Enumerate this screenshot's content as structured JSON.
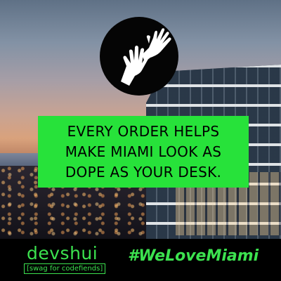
{
  "logo": {
    "icon": "reaching-hands-icon",
    "fill": "#050505",
    "hands": "#ffffff"
  },
  "banner": {
    "lines": [
      "EVERY ORDER HELPS",
      "MAKE MIAMI LOOK AS",
      "DOPE AS YOUR DESK."
    ],
    "background": "#27e23a"
  },
  "footer": {
    "brand": {
      "name": "devshui",
      "tagline": "[swag for codefiends]"
    },
    "hashtag": "#WeLoveMiami",
    "accent": "#3ce24f"
  }
}
